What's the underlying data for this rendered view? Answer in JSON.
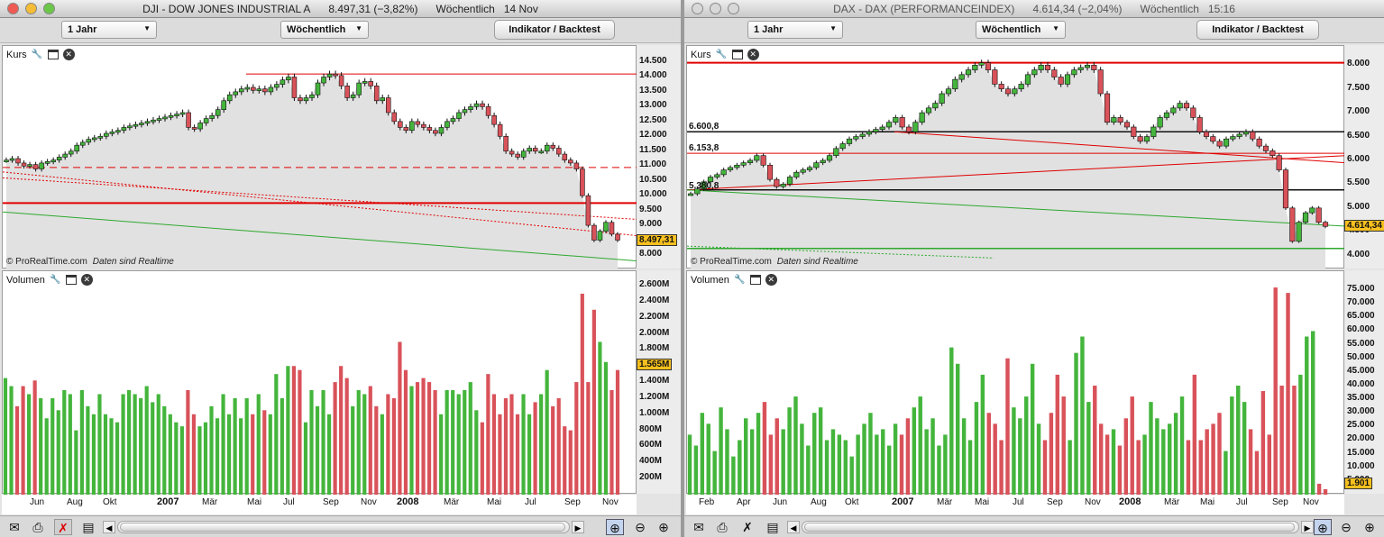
{
  "left": {
    "title": {
      "symbol": "DJI - DOW JONES INDUSTRIAL A",
      "price": "8.497,31 (−3,82%)",
      "period": "Wöchentlich",
      "date": "14 Nov"
    },
    "toolbar": {
      "range": "1 Jahr",
      "interval": "Wöchentlich",
      "indicator_button": "Indikator / Backtest"
    },
    "price_pane": {
      "label": "Kurs",
      "yticks": [
        "14.500",
        "14.000",
        "13.500",
        "13.000",
        "12.500",
        "12.000",
        "11.500",
        "11.000",
        "10.500",
        "10.000",
        "9.500",
        "9.000",
        "8.500",
        "8.000"
      ],
      "current": "8.497,31",
      "credit": "© ProRealTime.com",
      "credit_note": "Daten sind Realtime"
    },
    "volume_pane": {
      "label": "Volumen",
      "yticks": [
        "2.600M",
        "2.400M",
        "2.200M",
        "2.000M",
        "1.800M",
        "1.600M",
        "1.400M",
        "1.200M",
        "1.000M",
        "800M",
        "600M",
        "400M",
        "200M"
      ],
      "current": "1.565M"
    },
    "xticks": [
      "Jun",
      "Aug",
      "Okt",
      "2007",
      "Mär",
      "Mai",
      "Jul",
      "Sep",
      "Nov",
      "2008",
      "Mär",
      "Mai",
      "Jul",
      "Sep",
      "Nov"
    ],
    "close_series": [
      11200,
      11250,
      11100,
      11000,
      11050,
      10900,
      11100,
      11150,
      11200,
      11300,
      11400,
      11500,
      11700,
      11800,
      11900,
      11950,
      12000,
      12100,
      12150,
      12200,
      12300,
      12350,
      12400,
      12450,
      12500,
      12550,
      12600,
      12650,
      12700,
      12750,
      12800,
      12300,
      12250,
      12450,
      12600,
      12700,
      12900,
      13200,
      13400,
      13500,
      13600,
      13650,
      13550,
      13600,
      13500,
      13650,
      13750,
      13900,
      14000,
      13300,
      13200,
      13300,
      13400,
      13800,
      14000,
      14100,
      14050,
      13700,
      13300,
      13400,
      13800,
      13850,
      13700,
      13200,
      13300,
      12800,
      12500,
      12300,
      12200,
      12500,
      12400,
      12300,
      12200,
      12100,
      12300,
      12500,
      12600,
      12800,
      12900,
      13000,
      13100,
      13000,
      12700,
      12400,
      12000,
      11500,
      11400,
      11300,
      11500,
      11600,
      11500,
      11500,
      11700,
      11600,
      11400,
      11200,
      11100,
      10900,
      10000,
      9000,
      8500,
      8800,
      9100,
      8700,
      8500
    ],
    "volume_series": [
      1.45,
      1.35,
      1.1,
      1.35,
      1.25,
      1.42,
      1.2,
      0.95,
      1.2,
      1.05,
      1.3,
      1.25,
      0.8,
      1.3,
      1.1,
      1.0,
      1.25,
      1.0,
      0.95,
      0.9,
      1.25,
      1.3,
      1.25,
      1.2,
      1.35,
      1.15,
      1.25,
      1.1,
      1.0,
      0.9,
      0.85,
      1.3,
      1.0,
      0.85,
      0.9,
      1.1,
      0.95,
      1.25,
      1.0,
      1.2,
      0.95,
      1.2,
      1.0,
      1.25,
      1.05,
      1.0,
      1.5,
      1.2,
      1.6,
      1.6,
      1.55,
      0.9,
      1.3,
      1.1,
      1.3,
      1.0,
      1.4,
      1.6,
      1.45,
      1.1,
      1.3,
      1.25,
      1.35,
      1.1,
      1.0,
      1.25,
      1.2,
      1.9,
      1.55,
      1.35,
      1.4,
      1.45,
      1.4,
      1.3,
      1.0,
      1.3,
      1.3,
      1.25,
      1.3,
      1.4,
      1.05,
      0.9,
      1.5,
      1.25,
      1.0,
      1.2,
      1.25,
      1.0,
      1.25,
      1.0,
      1.15,
      1.25,
      1.55,
      1.1,
      1.2,
      0.85,
      0.8,
      1.4,
      2.5,
      1.4,
      2.3,
      1.9,
      1.65,
      1.3,
      1.55
    ],
    "colors": {
      "up": "#44b53c",
      "down": "#d9525a",
      "area": "#e1e1e1",
      "level_red": "#e00000",
      "trend_green": "#2ea82e"
    }
  },
  "right": {
    "title": {
      "symbol": "DAX - DAX (PERFORMANCEINDEX)",
      "price": "4.614,34 (−2,04%)",
      "period": "Wöchentlich",
      "date": "15:16"
    },
    "toolbar": {
      "range": "1 Jahr",
      "interval": "Wöchentlich",
      "indicator_button": "Indikator / Backtest"
    },
    "price_pane": {
      "label": "Kurs",
      "yticks": [
        "8.000",
        "7.500",
        "7.000",
        "6.500",
        "6.000",
        "5.500",
        "5.000",
        "4.500",
        "4.000"
      ],
      "current": "4.614,34",
      "level_labels": [
        "6.600,8",
        "6.153,8",
        "5.380,8"
      ],
      "credit": "© ProRealTime.com",
      "credit_note": "Daten sind Realtime"
    },
    "volume_pane": {
      "label": "Volumen",
      "yticks": [
        "75.000",
        "70.000",
        "65.000",
        "60.000",
        "55.000",
        "50.000",
        "45.000",
        "40.000",
        "35.000",
        "30.000",
        "25.000",
        "20.000",
        "15.000",
        "10.000",
        "5.000"
      ],
      "current": "1.901"
    },
    "xticks": [
      "Feb",
      "Apr",
      "Jun",
      "Aug",
      "Okt",
      "2007",
      "Mär",
      "Mai",
      "Jul",
      "Sep",
      "Nov",
      "2008",
      "Mär",
      "Mai",
      "Jul",
      "Sep",
      "Nov"
    ],
    "close_series": [
      5300,
      5400,
      5550,
      5650,
      5700,
      5800,
      5850,
      5900,
      5950,
      6000,
      6100,
      5900,
      5600,
      5450,
      5500,
      5650,
      5750,
      5800,
      5850,
      5950,
      6000,
      6100,
      6250,
      6350,
      6450,
      6500,
      6550,
      6600,
      6650,
      6700,
      6800,
      6900,
      6700,
      6600,
      6800,
      7000,
      7100,
      7200,
      7400,
      7500,
      7700,
      7800,
      7900,
      8000,
      8050,
      7900,
      7600,
      7500,
      7400,
      7500,
      7600,
      7800,
      7900,
      8000,
      7900,
      7750,
      7600,
      7800,
      7900,
      7950,
      8000,
      7900,
      7400,
      6800,
      6900,
      6800,
      6700,
      6500,
      6400,
      6500,
      6700,
      6900,
      7000,
      7100,
      7200,
      7100,
      6900,
      6600,
      6500,
      6400,
      6300,
      6450,
      6500,
      6550,
      6600,
      6450,
      6300,
      6200,
      6100,
      5800,
      5000,
      4300,
      4700,
      4900,
      5000,
      4700,
      4614
    ],
    "volume_series": [
      22,
      18,
      30,
      26,
      16,
      32,
      24,
      14,
      20,
      28,
      24,
      30,
      34,
      22,
      28,
      24,
      32,
      36,
      26,
      18,
      30,
      32,
      20,
      24,
      22,
      20,
      14,
      22,
      26,
      30,
      22,
      24,
      18,
      26,
      22,
      28,
      32,
      36,
      24,
      28,
      18,
      22,
      54,
      48,
      28,
      20,
      34,
      44,
      30,
      26,
      20,
      50,
      32,
      28,
      36,
      48,
      26,
      20,
      30,
      44,
      36,
      20,
      52,
      58,
      34,
      40,
      26,
      22,
      24,
      18,
      28,
      36,
      20,
      22,
      34,
      28,
      24,
      26,
      30,
      36,
      20,
      44,
      20,
      24,
      26,
      30,
      16,
      36,
      40,
      34,
      24,
      16,
      38,
      22,
      76,
      40,
      74,
      40,
      44,
      58,
      60,
      4,
      2
    ],
    "colors": {
      "up": "#44b53c",
      "down": "#d9525a",
      "area": "#e1e1e1",
      "level_red": "#e00000",
      "trend_green": "#2ea82e"
    }
  },
  "bottombar": {
    "icons": [
      "envelope-icon",
      "printer-icon",
      "disabled-tool-icon",
      "notes-icon",
      "scroll-left-icon",
      "scroll-right-icon",
      "zoom-fit-icon",
      "zoom-out-icon",
      "zoom-in-icon"
    ]
  }
}
